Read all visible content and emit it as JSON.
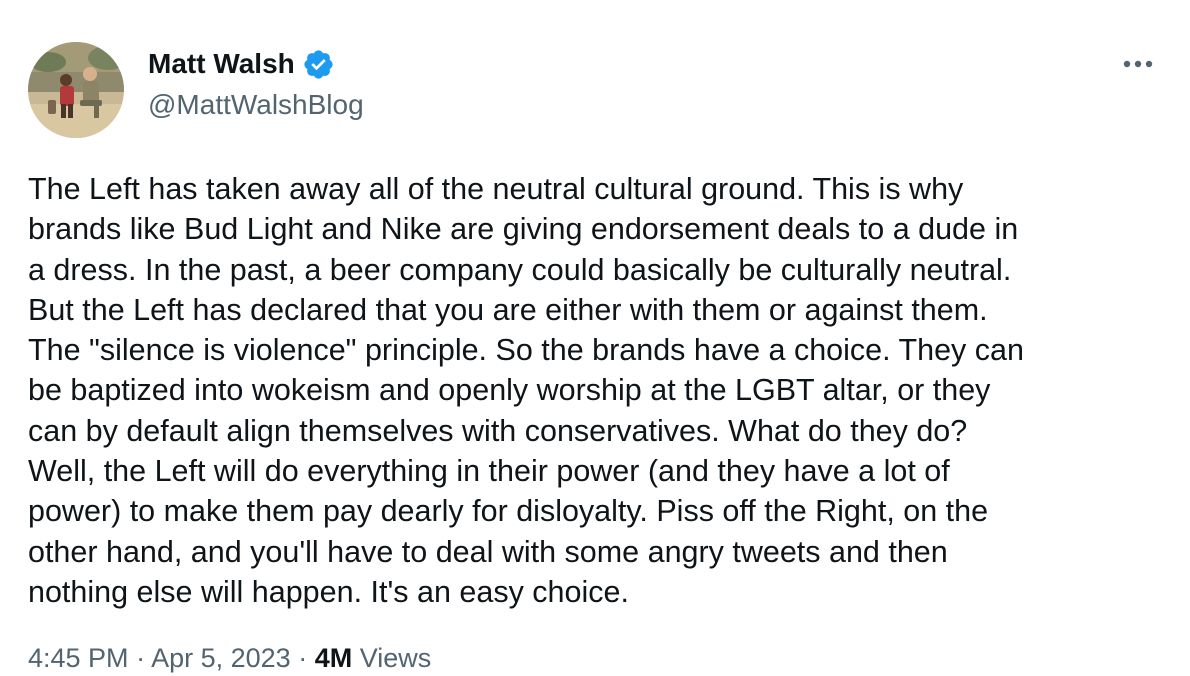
{
  "author": {
    "display_name": "Matt Walsh",
    "handle": "@MattWalshBlog",
    "verified_color": "#1d9bf0"
  },
  "tweet": {
    "lines": [
      "The Left has taken away all of the neutral cultural ground. This is why",
      "brands like Bud Light and Nike are giving endorsement deals to a dude in",
      "a dress. In the past, a beer company could basically be culturally neutral.",
      "But the Left has declared that you are either with them or against them.",
      "The \"silence is violence\" principle. So the brands have a choice. They can",
      "be baptized into wokeism and openly worship at the LGBT altar, or they",
      "can by default align themselves with conservatives. What do they do?",
      "Well, the Left will do everything in their power (and they have a lot of",
      "power) to make them pay dearly for disloyalty. Piss off the Right, on the",
      "other hand, and you'll have to deal with some angry tweets and then",
      "nothing else will happen. It's an easy choice."
    ]
  },
  "meta": {
    "time": "4:45 PM",
    "separator": "·",
    "date": "Apr 5, 2023",
    "views_count": "4M",
    "views_label": "Views"
  },
  "icons": {
    "verified": "verified-badge-icon",
    "more": "more-horizontal-icon"
  }
}
